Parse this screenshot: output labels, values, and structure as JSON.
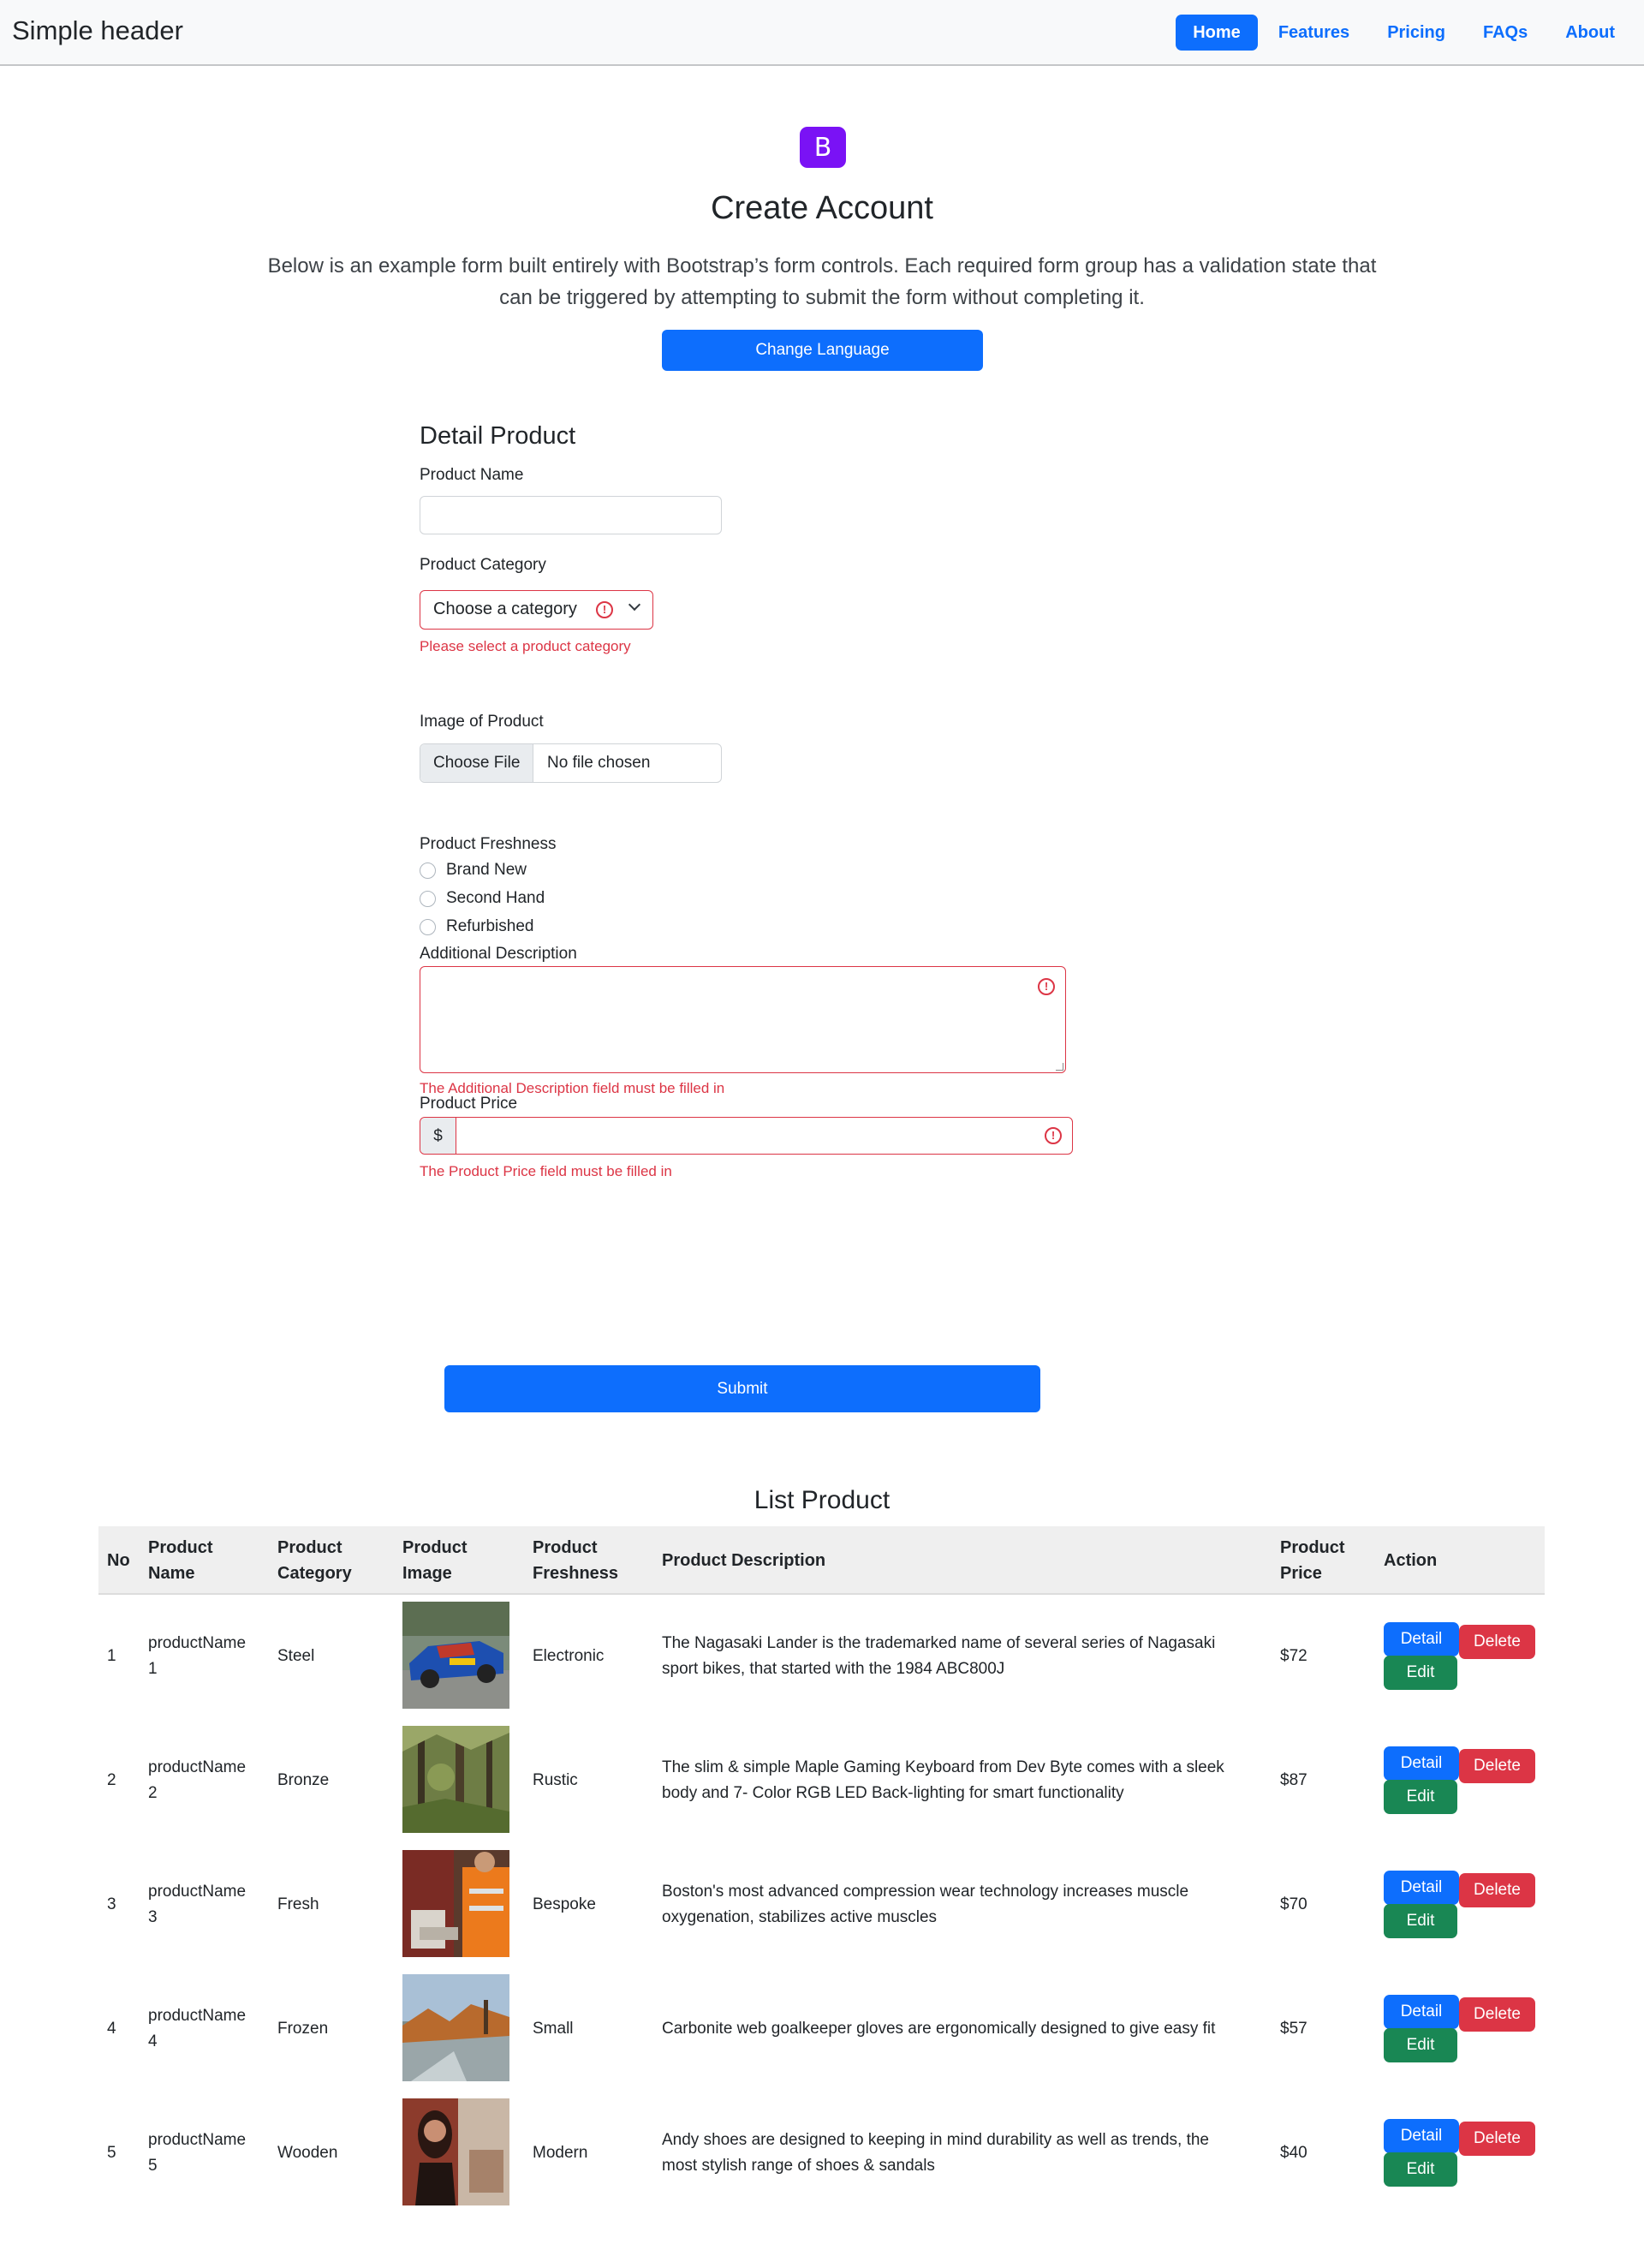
{
  "header": {
    "brand": "Simple header",
    "nav": [
      "Home",
      "Features",
      "Pricing",
      "FAQs",
      "About"
    ],
    "active": "Home"
  },
  "hero": {
    "logo_letter": "B",
    "title": "Create Account",
    "lead": "Below is an example form built entirely with Bootstrap’s form controls. Each required form group has a validation state that can be triggered by attempting to submit the form without completing it.",
    "change_language": "Change Language"
  },
  "form": {
    "title": "Detail Product",
    "product_name_label": "Product Name",
    "product_name_value": "",
    "category_label": "Product Category",
    "category_selected": "Choose a category",
    "category_error": "Please select a product category",
    "image_label": "Image of Product",
    "file_button": "Choose File",
    "file_status": "No file chosen",
    "freshness_label": "Product Freshness",
    "freshness_options": [
      "Brand New",
      "Second Hand",
      "Refurbished"
    ],
    "description_label": "Additional Description",
    "description_error": "The Additional Description field must be filled in",
    "price_label": "Product Price",
    "price_prefix": "$",
    "price_error": "The Product Price field must be filled in",
    "submit": "Submit"
  },
  "list": {
    "title": "List Product",
    "headers": {
      "no": "No",
      "name": [
        "Product",
        "Name"
      ],
      "category": [
        "Product",
        "Category"
      ],
      "image": [
        "Product",
        "Image"
      ],
      "freshness": [
        "Product",
        "Freshness"
      ],
      "description": "Product Description",
      "price": [
        "Product",
        "Price"
      ],
      "action": "Action"
    },
    "buttons": {
      "detail": "Detail",
      "delete": "Delete",
      "edit": "Edit"
    },
    "rows": [
      {
        "no": "1",
        "name": [
          "productName",
          "1"
        ],
        "category": "Steel",
        "image": "race-car-photo",
        "freshness": "Electronic",
        "description": [
          "The Nagasaki Lander is the trademarked name of several series of Nagasaki",
          "sport bikes, that started with the 1984 ABC800J"
        ],
        "price": "$72"
      },
      {
        "no": "2",
        "name": [
          "productName",
          "2"
        ],
        "category": "Bronze",
        "image": "forest-trees-photo",
        "freshness": "Rustic",
        "description": [
          "The slim & simple Maple Gaming Keyboard from Dev Byte comes with a sleek",
          "body and 7- Color RGB LED Back-lighting for smart functionality"
        ],
        "price": "$87"
      },
      {
        "no": "3",
        "name": [
          "productName",
          "3"
        ],
        "category": "Fresh",
        "image": "worker-in-orange-photo",
        "freshness": "Bespoke",
        "description": [
          "Boston's most advanced compression wear technology increases muscle",
          "oxygenation, stabilizes active muscles"
        ],
        "price": "$70"
      },
      {
        "no": "4",
        "name": [
          "productName",
          "4"
        ],
        "category": "Frozen",
        "image": "autumn-landscape-photo",
        "freshness": "Small",
        "description": [
          "Carbonite web goalkeeper gloves are ergonomically designed to give easy fit",
          ""
        ],
        "price": "$57"
      },
      {
        "no": "5",
        "name": [
          "productName",
          "5"
        ],
        "category": "Wooden",
        "image": "portrait-in-room-photo",
        "freshness": "Modern",
        "description": [
          "Andy shoes are designed to keeping in mind durability as well as trends, the",
          "most stylish range of shoes & sandals"
        ],
        "price": "$40"
      }
    ]
  }
}
